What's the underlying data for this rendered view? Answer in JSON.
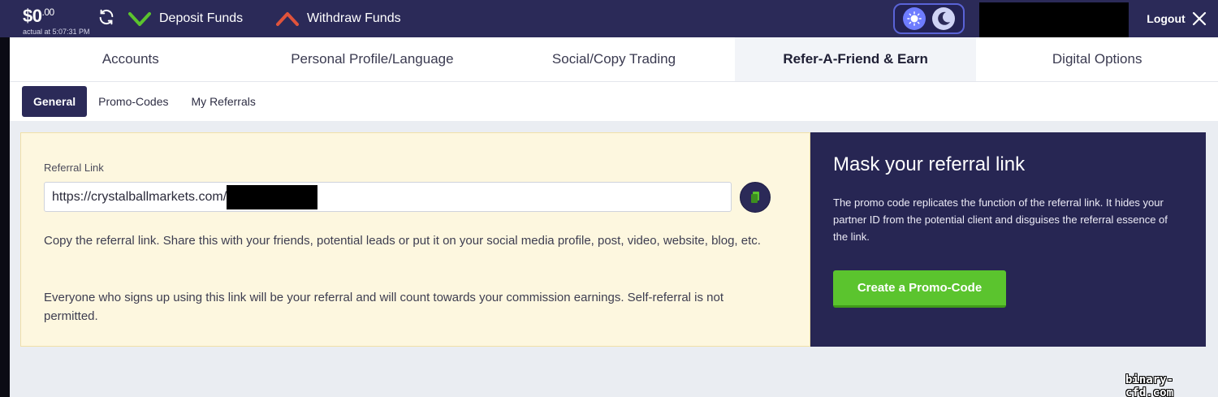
{
  "header": {
    "balance_currency": "$",
    "balance_whole": "0",
    "balance_cents": ".00",
    "balance_time": "actual at 5:07:31 PM",
    "deposit_label": "Deposit Funds",
    "withdraw_label": "Withdraw Funds",
    "logout_label": "Logout"
  },
  "main_tabs": [
    {
      "label": "Accounts",
      "active": false
    },
    {
      "label": "Personal Profile/Language",
      "active": false
    },
    {
      "label": "Social/Copy Trading",
      "active": false
    },
    {
      "label": "Refer-A-Friend & Earn",
      "active": true
    },
    {
      "label": "Digital Options",
      "active": false
    }
  ],
  "sub_tabs": [
    {
      "label": "General",
      "active": true
    },
    {
      "label": "Promo-Codes",
      "active": false
    },
    {
      "label": "My Referrals",
      "active": false
    }
  ],
  "referral": {
    "label": "Referral Link",
    "link_value": "https://crystalballmarkets.com/",
    "paragraph1": "Copy the referral link. Share this with your friends, potential leads or put it on your social media profile, post, video, website, blog, etc.",
    "paragraph2": "Everyone who signs up using this link will be your referral and will count towards your commission earnings. Self-referral is not permitted."
  },
  "mask": {
    "title": "Mask your referral link",
    "description": "The promo code replicates the function of the referral link. It hides your partner ID from the potential client and disguises the referral essence of the link.",
    "button_label": "Create a Promo-Code"
  },
  "watermark": "binary-cfd.com",
  "colors": {
    "header_bg": "#2b2a58",
    "accent_green": "#5bc42e",
    "deposit_icon": "#5bc42e",
    "withdraw_icon": "#e0533b",
    "referral_panel_bg": "#fdf7df",
    "mask_panel_bg": "#272653"
  },
  "icons": {
    "refresh": "refresh-icon",
    "deposit": "check-arrow-down-icon",
    "withdraw": "caret-up-icon",
    "sun": "sun-icon",
    "moon": "moon-icon",
    "logout": "close-icon",
    "copy": "copy-icon"
  }
}
